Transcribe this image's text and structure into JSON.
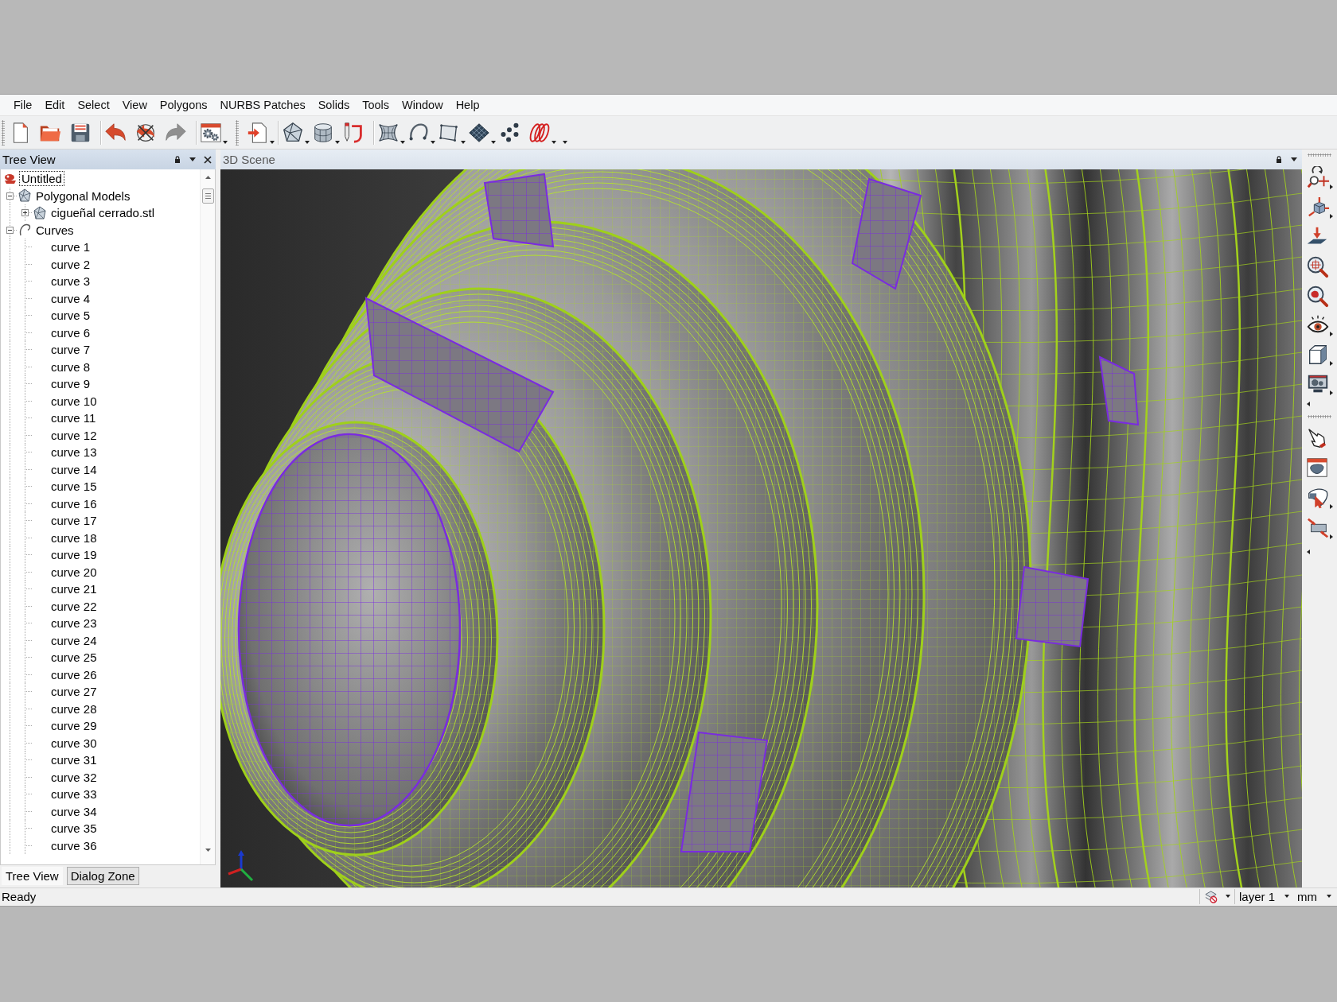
{
  "menu_bar": [
    {
      "label": "File"
    },
    {
      "label": "Edit"
    },
    {
      "label": "Select"
    },
    {
      "label": "View"
    },
    {
      "label": "Polygons"
    },
    {
      "label": "NURBS Patches"
    },
    {
      "label": "Solids"
    },
    {
      "label": "Tools"
    },
    {
      "label": "Window"
    },
    {
      "label": "Help"
    }
  ],
  "toolbars": [
    {
      "overflow": false,
      "groups": [
        [
          {
            "kind": "new",
            "dropdown": false,
            "disabled": false
          },
          {
            "kind": "open",
            "dropdown": false,
            "disabled": false
          },
          {
            "kind": "save",
            "dropdown": false,
            "disabled": false
          }
        ],
        [
          {
            "kind": "undo",
            "dropdown": false,
            "disabled": false
          },
          {
            "kind": "revert",
            "dropdown": false,
            "disabled": false
          },
          {
            "kind": "redo",
            "dropdown": false,
            "disabled": true
          }
        ],
        [
          {
            "kind": "settings",
            "dropdown": true,
            "disabled": false
          }
        ]
      ]
    },
    {
      "overflow": true,
      "groups": [
        [
          {
            "kind": "import",
            "dropdown": true,
            "disabled": false
          }
        ],
        [
          {
            "kind": "mesh",
            "dropdown": true,
            "disabled": false
          },
          {
            "kind": "cylinder",
            "dropdown": true,
            "disabled": false
          },
          {
            "kind": "sketch",
            "dropdown": false,
            "disabled": false
          }
        ],
        [
          {
            "kind": "surface",
            "dropdown": true,
            "disabled": false
          },
          {
            "kind": "arc",
            "dropdown": true,
            "disabled": false
          },
          {
            "kind": "patch",
            "dropdown": true,
            "disabled": false
          },
          {
            "kind": "grid",
            "dropdown": true,
            "disabled": false
          },
          {
            "kind": "points",
            "dropdown": false,
            "disabled": false
          },
          {
            "kind": "loops",
            "dropdown": true,
            "disabled": false
          }
        ]
      ]
    }
  ],
  "tree_view": {
    "title": "Tree View",
    "root": {
      "label": "Untitled",
      "kind": "document",
      "selected": true,
      "children": [
        {
          "label": "Polygonal Models",
          "kind": "mesh",
          "expanded": true,
          "selected": false,
          "children": [
            {
              "label": "cigueñal cerrado.stl",
              "kind": "mesh",
              "expanded": false,
              "selected": false
            }
          ]
        },
        {
          "label": "Curves",
          "kind": "curves",
          "expanded": true,
          "selected": false,
          "children": [
            {
              "label": "curve 1",
              "kind": "curve",
              "selected": false
            },
            {
              "label": "curve 2",
              "kind": "curve",
              "selected": false
            },
            {
              "label": "curve 3",
              "kind": "curve",
              "selected": false
            },
            {
              "label": "curve 4",
              "kind": "curve",
              "selected": false
            },
            {
              "label": "curve 5",
              "kind": "curve",
              "selected": false
            },
            {
              "label": "curve 6",
              "kind": "curve",
              "selected": false
            },
            {
              "label": "curve 7",
              "kind": "curve",
              "selected": false
            },
            {
              "label": "curve 8",
              "kind": "curve",
              "selected": false
            },
            {
              "label": "curve 9",
              "kind": "curve",
              "selected": false
            },
            {
              "label": "curve 10",
              "kind": "curve",
              "selected": false
            },
            {
              "label": "curve 11",
              "kind": "curve",
              "selected": false
            },
            {
              "label": "curve 12",
              "kind": "curve",
              "selected": false
            },
            {
              "label": "curve 13",
              "kind": "curve",
              "selected": false
            },
            {
              "label": "curve 14",
              "kind": "curve",
              "selected": false
            },
            {
              "label": "curve 15",
              "kind": "curve",
              "selected": false
            },
            {
              "label": "curve 16",
              "kind": "curve",
              "selected": false
            },
            {
              "label": "curve 17",
              "kind": "curve",
              "selected": false
            },
            {
              "label": "curve 18",
              "kind": "curve",
              "selected": false
            },
            {
              "label": "curve 19",
              "kind": "curve",
              "selected": false
            },
            {
              "label": "curve 20",
              "kind": "curve",
              "selected": false
            },
            {
              "label": "curve 21",
              "kind": "curve",
              "selected": false
            },
            {
              "label": "curve 22",
              "kind": "curve",
              "selected": false
            },
            {
              "label": "curve 23",
              "kind": "curve",
              "selected": false
            },
            {
              "label": "curve 24",
              "kind": "curve",
              "selected": false
            },
            {
              "label": "curve 25",
              "kind": "curve",
              "selected": false
            },
            {
              "label": "curve 26",
              "kind": "curve",
              "selected": false
            },
            {
              "label": "curve 27",
              "kind": "curve",
              "selected": false
            },
            {
              "label": "curve 28",
              "kind": "curve",
              "selected": false
            },
            {
              "label": "curve 29",
              "kind": "curve",
              "selected": false
            },
            {
              "label": "curve 30",
              "kind": "curve",
              "selected": false
            },
            {
              "label": "curve 31",
              "kind": "curve",
              "selected": false
            },
            {
              "label": "curve 32",
              "kind": "curve",
              "selected": false
            },
            {
              "label": "curve 33",
              "kind": "curve",
              "selected": false
            },
            {
              "label": "curve 34",
              "kind": "curve",
              "selected": false
            },
            {
              "label": "curve 35",
              "kind": "curve",
              "selected": false
            },
            {
              "label": "curve 36",
              "kind": "curve",
              "selected": false
            }
          ]
        }
      ]
    }
  },
  "dock_tabs": [
    {
      "label": "Tree View",
      "selected": true
    },
    {
      "label": "Dialog Zone",
      "selected": false
    }
  ],
  "scene": {
    "title": "3D Scene"
  },
  "view_toolbars": [
    {
      "overflow": true,
      "buttons": [
        {
          "kind": "orbit",
          "dropdown": true,
          "disabled": false
        },
        {
          "kind": "cube",
          "dropdown": true,
          "disabled": false
        },
        {
          "kind": "plane",
          "dropdown": false,
          "disabled": false
        },
        {
          "kind": "fit",
          "dropdown": false,
          "disabled": false
        },
        {
          "kind": "zoom",
          "dropdown": false,
          "disabled": false
        },
        {
          "kind": "eye",
          "dropdown": true,
          "disabled": false
        },
        {
          "kind": "views",
          "dropdown": true,
          "disabled": false
        },
        {
          "kind": "display",
          "dropdown": true,
          "disabled": false
        }
      ]
    },
    {
      "overflow": true,
      "buttons": [
        {
          "kind": "pick",
          "dropdown": false,
          "disabled": false
        },
        {
          "kind": "panel",
          "dropdown": false,
          "disabled": false
        },
        {
          "kind": "shape",
          "dropdown": true,
          "disabled": false
        },
        {
          "kind": "transform",
          "dropdown": true,
          "disabled": false
        }
      ]
    }
  ],
  "status_bar": {
    "message": "Ready",
    "layer": "layer 1",
    "units": "mm"
  }
}
